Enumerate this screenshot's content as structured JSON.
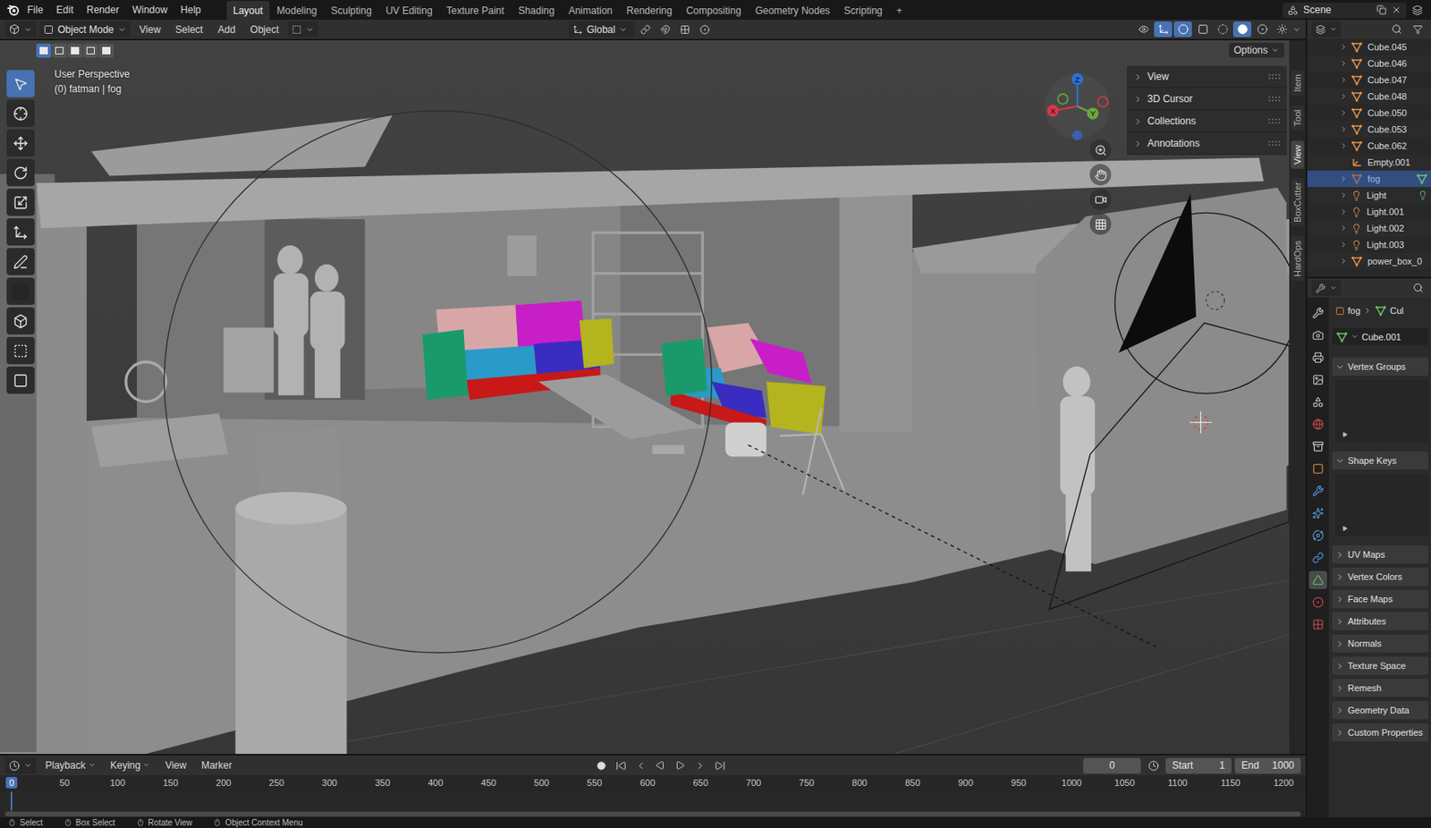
{
  "top_menu": [
    "File",
    "Edit",
    "Render",
    "Window",
    "Help"
  ],
  "workspaces": [
    {
      "label": "Layout",
      "selected": true
    },
    {
      "label": "Modeling",
      "selected": false
    },
    {
      "label": "Sculpting",
      "selected": false
    },
    {
      "label": "UV Editing",
      "selected": false
    },
    {
      "label": "Texture Paint",
      "selected": false
    },
    {
      "label": "Shading",
      "selected": false
    },
    {
      "label": "Animation",
      "selected": false
    },
    {
      "label": "Rendering",
      "selected": false
    },
    {
      "label": "Compositing",
      "selected": false
    },
    {
      "label": "Geometry Nodes",
      "selected": false
    },
    {
      "label": "Scripting",
      "selected": false
    }
  ],
  "add_workspace": "+",
  "scene": "Scene",
  "header": {
    "mode": "Object Mode",
    "menus": [
      "View",
      "Select",
      "Add",
      "Object"
    ],
    "orientation": "Global",
    "shading": [
      {
        "kind": "wireframe",
        "selected": false
      },
      {
        "kind": "solid",
        "selected": true
      },
      {
        "kind": "material",
        "selected": false
      },
      {
        "kind": "rendered",
        "selected": false
      }
    ]
  },
  "select_modes": [
    {
      "selected": true
    },
    {
      "selected": false
    },
    {
      "selected": false
    },
    {
      "selected": false
    },
    {
      "selected": false
    }
  ],
  "viewport": {
    "perspective": "User Perspective",
    "context": "(0) fatman | fog",
    "options": "Options"
  },
  "gizmo": [
    {
      "label": "Z",
      "color": "#2f6fd8"
    },
    {
      "label": "Y",
      "color": "#6ba73a"
    },
    {
      "label": "X",
      "color": "#d8364c"
    }
  ],
  "tools": [
    {
      "kind": "select",
      "selected": true
    },
    {
      "kind": "cursor",
      "selected": false
    },
    {
      "kind": "move",
      "selected": false
    },
    {
      "kind": "rotate",
      "selected": false
    },
    {
      "kind": "scale",
      "selected": false
    },
    {
      "kind": "transform",
      "selected": false
    },
    {
      "kind": "annotate",
      "selected": false
    },
    {
      "kind": "measure",
      "selected": false
    },
    {
      "kind": "add_cube",
      "selected": false
    },
    {
      "kind": "boxcut",
      "selected": false
    },
    {
      "kind": "hops",
      "selected": false
    }
  ],
  "n_panel": {
    "sections": [
      "View",
      "3D Cursor",
      "Collections",
      "Annotations"
    ],
    "tabs": [
      {
        "label": "Item",
        "selected": false
      },
      {
        "label": "Tool",
        "selected": false
      },
      {
        "label": "View",
        "selected": true
      },
      {
        "label": "BoxCutter",
        "selected": false
      },
      {
        "label": "HardOps",
        "selected": false
      }
    ]
  },
  "outliner": [
    {
      "name": "Cube.045",
      "kind": "mesh",
      "selected": false,
      "expandable": true,
      "show_data": false
    },
    {
      "name": "Cube.046",
      "kind": "mesh",
      "selected": false,
      "expandable": true,
      "show_data": false
    },
    {
      "name": "Cube.047",
      "kind": "mesh",
      "selected": false,
      "expandable": true,
      "show_data": false
    },
    {
      "name": "Cube.048",
      "kind": "mesh",
      "selected": false,
      "expandable": true,
      "show_data": false
    },
    {
      "name": "Cube.050",
      "kind": "mesh",
      "selected": false,
      "expandable": true,
      "show_data": false
    },
    {
      "name": "Cube.053",
      "kind": "mesh",
      "selected": false,
      "expandable": true,
      "show_data": false
    },
    {
      "name": "Cube.062",
      "kind": "mesh",
      "selected": false,
      "expandable": true,
      "show_data": false
    },
    {
      "name": "Empty.001",
      "kind": "empty",
      "selected": false,
      "expandable": false,
      "show_data": false
    },
    {
      "name": "fog",
      "kind": "mesh",
      "selected": true,
      "expandable": true,
      "show_data": true
    },
    {
      "name": "Light",
      "kind": "light",
      "selected": false,
      "expandable": true,
      "show_data": true
    },
    {
      "name": "Light.001",
      "kind": "light",
      "selected": false,
      "expandable": true,
      "show_data": false
    },
    {
      "name": "Light.002",
      "kind": "light",
      "selected": false,
      "expandable": true,
      "show_data": false
    },
    {
      "name": "Light.003",
      "kind": "light",
      "selected": false,
      "expandable": true,
      "show_data": false
    },
    {
      "name": "power_box_0",
      "kind": "mesh",
      "selected": false,
      "expandable": true,
      "show_data": false
    }
  ],
  "properties": {
    "tabs": [
      {
        "kind": "tool",
        "selected": false
      },
      {
        "kind": "render",
        "selected": false
      },
      {
        "kind": "output",
        "selected": false
      },
      {
        "kind": "view_layer",
        "selected": false
      },
      {
        "kind": "scene",
        "selected": false
      },
      {
        "kind": "world",
        "selected": false
      },
      {
        "kind": "collection",
        "selected": false
      },
      {
        "kind": "object",
        "selected": false
      },
      {
        "kind": "modifiers",
        "selected": false
      },
      {
        "kind": "particles",
        "selected": false
      },
      {
        "kind": "physics",
        "selected": false
      },
      {
        "kind": "constraints",
        "selected": false
      },
      {
        "kind": "data",
        "selected": true
      },
      {
        "kind": "material",
        "selected": false
      },
      {
        "kind": "texture",
        "selected": false
      }
    ],
    "breadcrumb": [
      "fog",
      "Cul"
    ],
    "mesh_name": "Cube.001",
    "panels": [
      {
        "label": "Vertex Groups",
        "expanded": true
      },
      {
        "label": "Shape Keys",
        "expanded": true
      },
      {
        "label": "UV Maps",
        "expanded": false
      },
      {
        "label": "Vertex Colors",
        "expanded": false
      },
      {
        "label": "Face Maps",
        "expanded": false
      },
      {
        "label": "Attributes",
        "expanded": false
      },
      {
        "label": "Normals",
        "expanded": false
      },
      {
        "label": "Texture Space",
        "expanded": false
      },
      {
        "label": "Remesh",
        "expanded": false
      },
      {
        "label": "Geometry Data",
        "expanded": false
      },
      {
        "label": "Custom Properties",
        "expanded": false
      }
    ]
  },
  "timeline": {
    "menus": [
      {
        "label": "Playback",
        "dropdown": true
      },
      {
        "label": "Keying",
        "dropdown": true
      },
      {
        "label": "View",
        "dropdown": false
      },
      {
        "label": "Marker",
        "dropdown": false
      }
    ],
    "current_frame": "0",
    "start_label": "Start",
    "start": "1",
    "end_label": "End",
    "end": "1000",
    "ticks": [
      "0",
      "50",
      "100",
      "150",
      "200",
      "250",
      "300",
      "350",
      "400",
      "450",
      "500",
      "550",
      "600",
      "650",
      "700",
      "750",
      "800",
      "850",
      "900",
      "950",
      "1000",
      "1050",
      "1100",
      "1150",
      "1200"
    ]
  },
  "status_bar": [
    "Select",
    "Box Select",
    "Rotate View",
    "Object Context Menu"
  ]
}
